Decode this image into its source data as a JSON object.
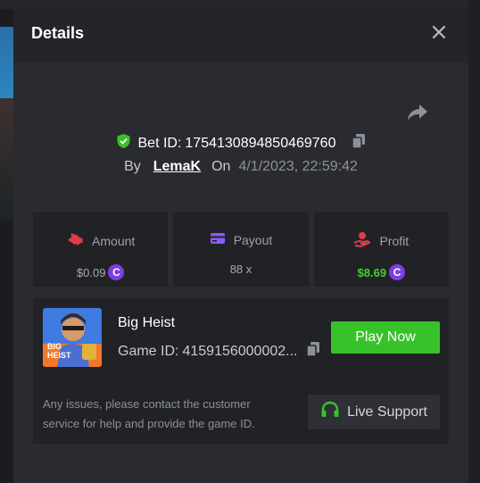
{
  "modal": {
    "title": "Details"
  },
  "bet": {
    "label": "Bet ID:",
    "id": "1754130894850469760",
    "by_label": "By",
    "user": "LemaK",
    "on_label": "On",
    "date": "4/1/2023, 22:59:42"
  },
  "stats": {
    "amount": {
      "label": "Amount",
      "value": "$0.09",
      "color": "#a8abb2"
    },
    "payout": {
      "label": "Payout",
      "value": "88 x",
      "color": "#a8abb2"
    },
    "profit": {
      "label": "Profit",
      "value": "$8.69",
      "color": "#41d12f"
    },
    "coin_glyph": "C"
  },
  "game": {
    "title": "Big Heist",
    "id_label": "Game ID:",
    "id_value": "4159156000002...",
    "thumb_text_1": "BIG",
    "thumb_text_2": "HEIST",
    "play_label": "Play Now",
    "support_text": "Any issues, please contact the customer service for help and provide the game ID.",
    "support_label": "Live Support"
  },
  "colors": {
    "accent_green": "#38c22a",
    "profit_green": "#41d12f",
    "coin_purple": "#7b3fe4",
    "icon_red": "#e23b4e",
    "icon_purple": "#8b5cf6"
  },
  "icons": [
    "close-icon",
    "share-icon",
    "shield-check-icon",
    "copy-icon",
    "amount-icon",
    "payout-card-icon",
    "profit-hand-icon",
    "headset-icon"
  ]
}
